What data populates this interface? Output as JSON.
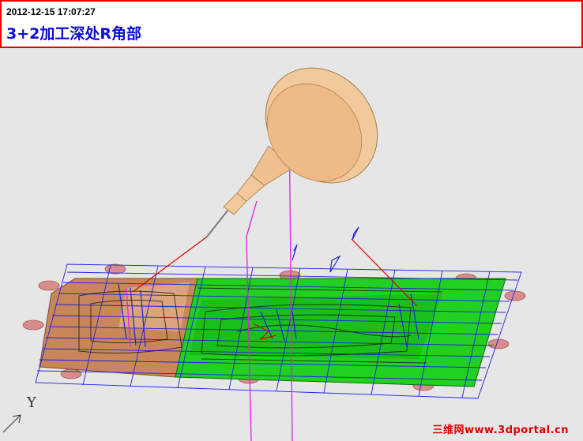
{
  "header": {
    "timestamp": "2012-12-15 17:07:27",
    "caption": "3+2加工深处R角部"
  },
  "viewport": {
    "axis_label": "Y",
    "colors": {
      "background": "#e6e6e6",
      "tool_body": "#f2c99a",
      "mold_wood": "#c9865a",
      "machined_surface": "#22d022",
      "toolpath_blue": "#2020e0",
      "toolpath_magenta": "#e020e0",
      "toolpath_red": "#e00000",
      "clamp_pads": "#d98c8c"
    }
  },
  "watermark": {
    "text": "三维网www.3dportal.cn"
  }
}
